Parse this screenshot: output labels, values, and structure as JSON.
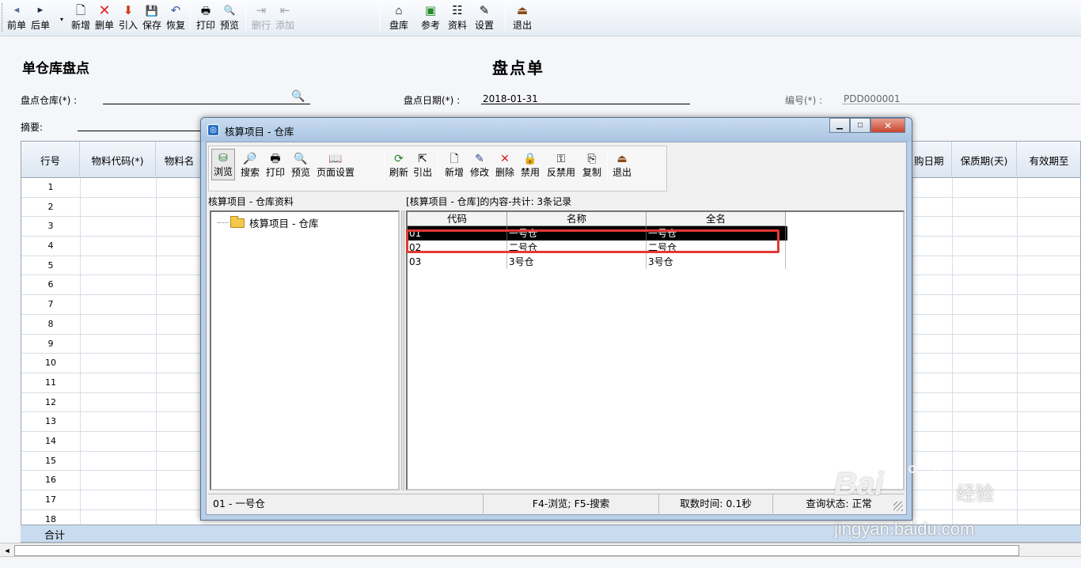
{
  "main_toolbar": {
    "buttons": [
      {
        "label": "前单",
        "icon": "◄"
      },
      {
        "label": "后单",
        "icon": "►"
      },
      {
        "label": "新增",
        "icon": "🗋"
      },
      {
        "label": "删单",
        "icon": "✕"
      },
      {
        "label": "引入",
        "icon": "⬇"
      },
      {
        "label": "保存",
        "icon": "💾"
      },
      {
        "label": "恢复",
        "icon": "↶"
      },
      {
        "label": "打印",
        "icon": "🖶"
      },
      {
        "label": "预览",
        "icon": "🔍"
      },
      {
        "label": "删行",
        "icon": "⇥"
      },
      {
        "label": "添加",
        "icon": "⇤"
      },
      {
        "label": "盘库",
        "icon": "⌂"
      },
      {
        "label": "参考",
        "icon": "▣"
      },
      {
        "label": "资料",
        "icon": "☷"
      },
      {
        "label": "设置",
        "icon": "✎"
      },
      {
        "label": "退出",
        "icon": "⏏"
      }
    ]
  },
  "document": {
    "type_title": "单仓库盘点",
    "main_title": "盘点单",
    "warehouse_label": "盘点仓库(*) :",
    "date_label": "盘点日期(*) :",
    "date_value": "2018-01-31",
    "number_label": "编号(*) :",
    "number_value": "PDD000001",
    "summary_label": "摘要:"
  },
  "grid": {
    "columns": [
      "行号",
      "物料代码(*)",
      "物料名",
      "购日期",
      "保质期(天)",
      "有效期至"
    ],
    "row_numbers": [
      "1",
      "2",
      "3",
      "4",
      "5",
      "6",
      "7",
      "8",
      "9",
      "10",
      "11",
      "12",
      "13",
      "14",
      "15",
      "16",
      "17",
      "18"
    ],
    "total_label": "合计"
  },
  "dialog": {
    "title": "核算项目 - 仓库",
    "toolbar": [
      {
        "label": "浏览",
        "icon": "⛁"
      },
      {
        "label": "搜索",
        "icon": "🔎"
      },
      {
        "label": "打印",
        "icon": "🖶"
      },
      {
        "label": "预览",
        "icon": "🔍"
      },
      {
        "label": "页面设置",
        "icon": "📖"
      },
      {
        "label": "刷新",
        "icon": "⟳"
      },
      {
        "label": "引出",
        "icon": "⇱"
      },
      {
        "label": "新增",
        "icon": "🗋"
      },
      {
        "label": "修改",
        "icon": "✎"
      },
      {
        "label": "删除",
        "icon": "✕"
      },
      {
        "label": "禁用",
        "icon": "🔒"
      },
      {
        "label": "反禁用",
        "icon": "⚿"
      },
      {
        "label": "复制",
        "icon": "⎘"
      },
      {
        "label": "退出",
        "icon": "⏏"
      }
    ],
    "left_caption": "核算项目 - 仓库资料",
    "right_caption": "[核算项目 - 仓库]的内容-共计: 3条记录",
    "tree_root": "核算项目 - 仓库",
    "columns": [
      "代码",
      "名称",
      "全名"
    ],
    "rows": [
      {
        "code": "01",
        "name": "一号仓",
        "full": "一号仓"
      },
      {
        "code": "02",
        "name": "二号仓",
        "full": "二号仓"
      },
      {
        "code": "03",
        "name": "3号仓",
        "full": "3号仓"
      }
    ],
    "status": {
      "selection": "01 - 一号仓",
      "hint": "F4-浏览; F5-搜索",
      "time": "取数时间: 0.1秒",
      "query": "查询状态: 正常"
    }
  },
  "watermark": {
    "brand": "Bai",
    "sub": "jingyan.baidu.com",
    "extra": "经验"
  }
}
